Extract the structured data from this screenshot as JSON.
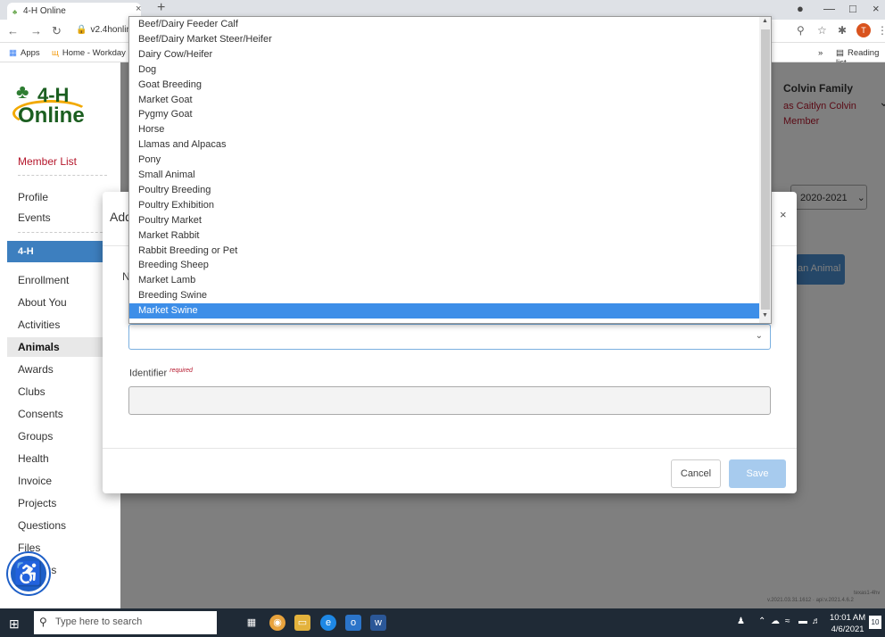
{
  "browser": {
    "tab_title": "4-H Online",
    "url": "v2.4honline",
    "bookmarks": [
      "Apps",
      "Home - Workday"
    ],
    "reading_list": "Reading list",
    "profile_initial": "T"
  },
  "sidebar": {
    "logo_line1": "4-H",
    "logo_line2": "Online",
    "member_list": "Member List",
    "top_links": [
      "Profile",
      "Events"
    ],
    "section_header": "4-H",
    "menu_items": [
      "Enrollment",
      "About You",
      "Activities",
      "Animals",
      "Awards",
      "Clubs",
      "Consents",
      "Groups",
      "Health",
      "Invoice",
      "Projects",
      "Questions",
      "Files",
      "Settings"
    ],
    "active_item": "Animals"
  },
  "header": {
    "family_name": "Colvin Family",
    "as_user": "as Caitlyn Colvin",
    "role": "Member",
    "year": "2020-2021",
    "add_animal_button": "an Animal"
  },
  "modal": {
    "title_visible": "Add",
    "truncated_label": "N",
    "identifier_label": "Identifier",
    "required_tag": "required",
    "cancel_label": "Cancel",
    "save_label": "Save"
  },
  "dropdown": {
    "options": [
      "Beef/Dairy Feeder Calf",
      "Beef/Dairy Market Steer/Heifer",
      "Dairy Cow/Heifer",
      "Dog",
      "Goat Breeding",
      "Market Goat",
      "Pygmy Goat",
      "Horse",
      "Llamas and Alpacas",
      "Pony",
      "Small Animal",
      "Poultry Breeding",
      "Poultry Exhibition",
      "Poultry Market",
      "Market Rabbit",
      "Rabbit Breeding or Pet",
      "Breeding Sheep",
      "Market Lamb",
      "Breeding Swine",
      "Market Swine"
    ],
    "selected_index": 19
  },
  "footer": {
    "version_line1": "texas1-4hv",
    "version_line2": "v.2021.03.31.1612 · api:v.2021.4.6.2"
  },
  "taskbar": {
    "search_placeholder": "Type here to search",
    "time": "10:01 AM",
    "date": "4/6/2021",
    "notification_count": "10"
  },
  "colors": {
    "accent_blue": "#3d7fbf",
    "brand_red": "#b5172c",
    "selected_option": "#3d8ee8"
  }
}
